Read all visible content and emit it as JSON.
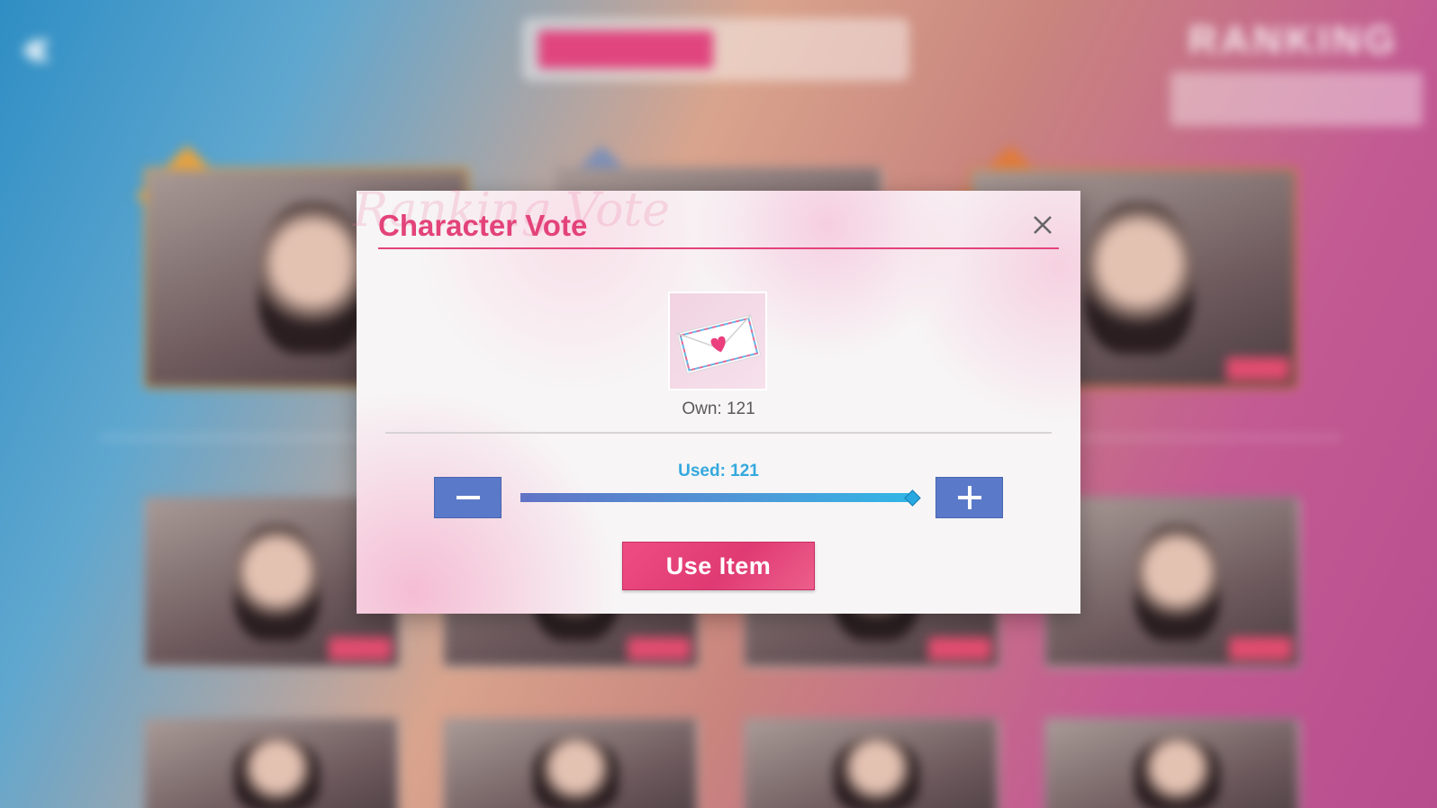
{
  "background": {
    "back_icon": "double-chevron-left-icon",
    "title": "RANKING"
  },
  "dialog": {
    "title": "Character Vote",
    "watermark": "Ranking Vote",
    "close_icon": "close-icon",
    "item_icon": "envelope-heart-icon",
    "own_label": "Own: 121",
    "own_value": 121,
    "used_label": "Used: 121",
    "used_value": 121,
    "minus_icon": "minus-icon",
    "plus_icon": "plus-icon",
    "use_button_label": "Use Item"
  },
  "colors": {
    "accent_pink": "#e3437a",
    "used_blue": "#33a9dd",
    "stepper_blue": "#5b79c9"
  }
}
